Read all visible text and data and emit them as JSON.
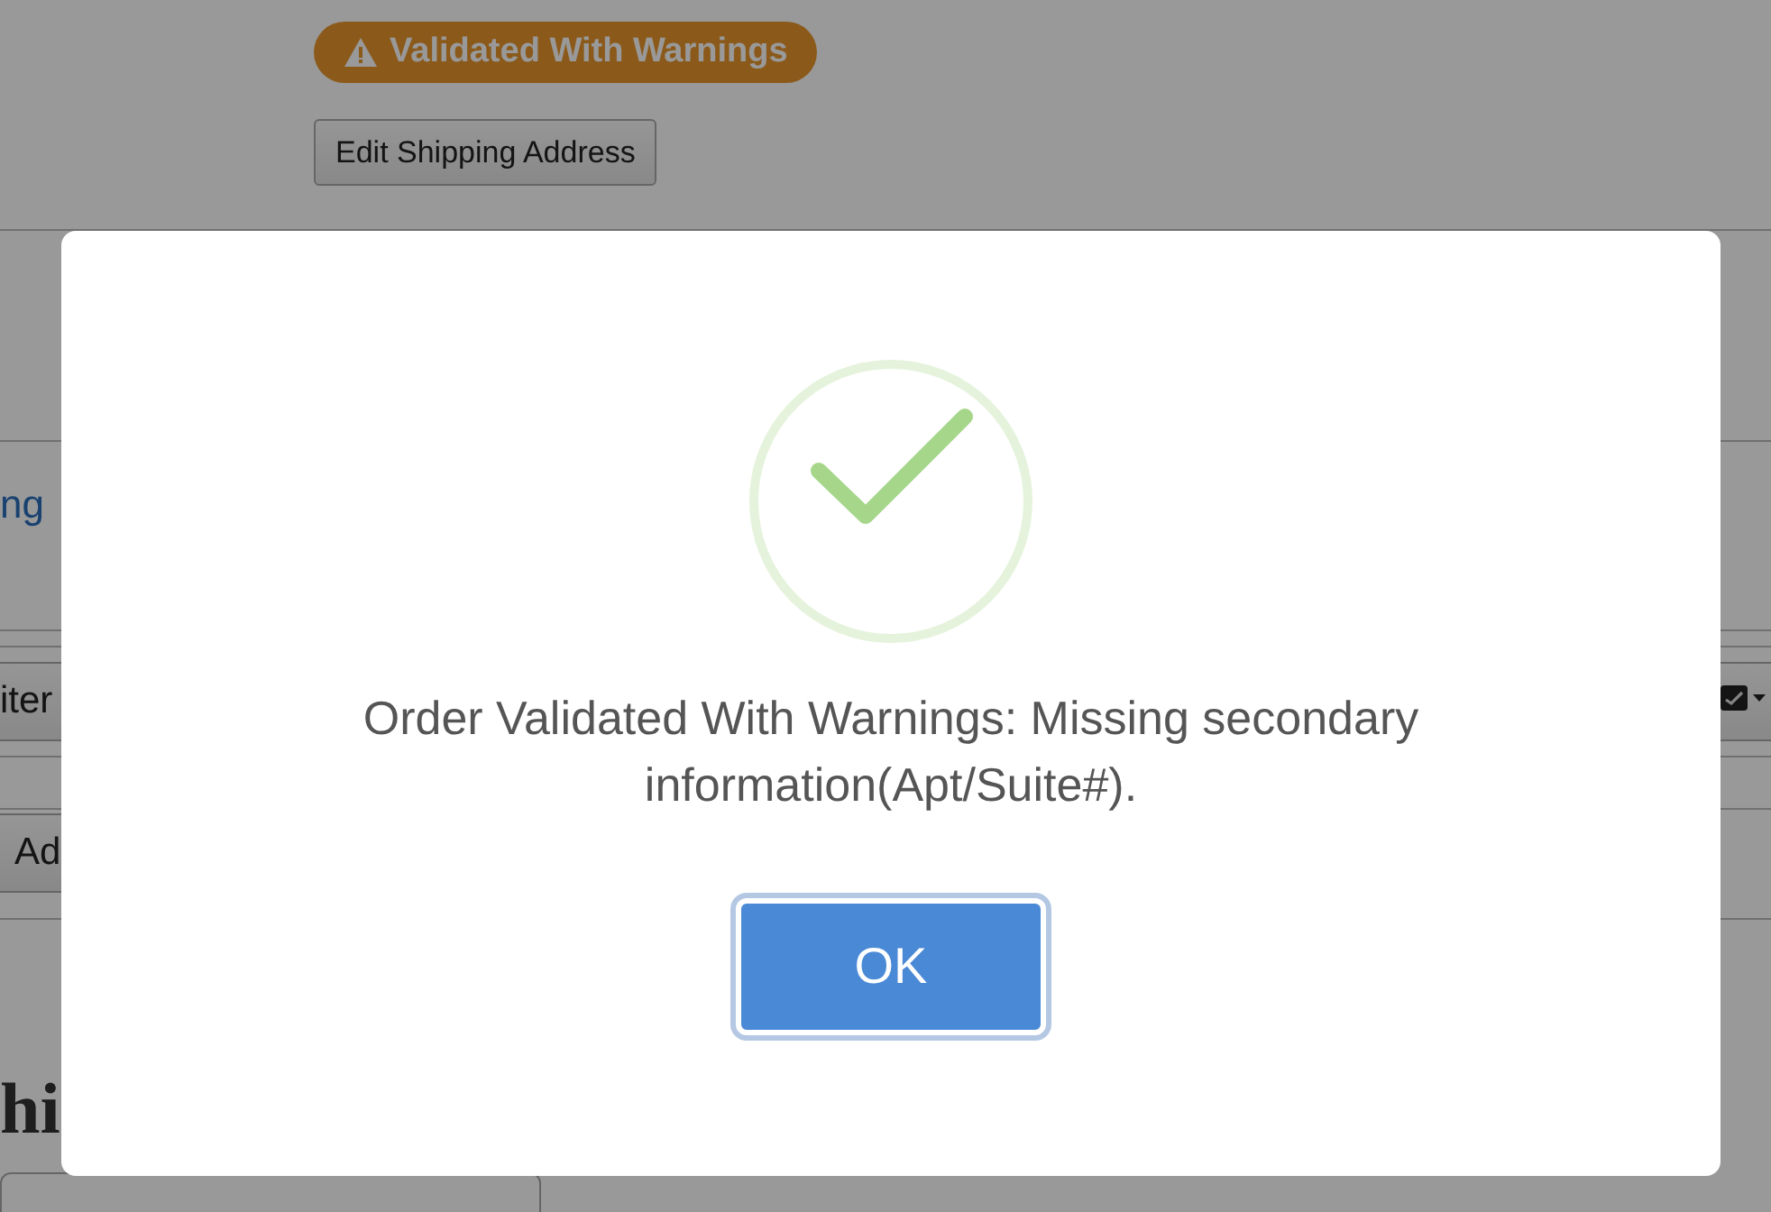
{
  "page": {
    "status_badge": {
      "label": "Validated With Warnings"
    },
    "edit_button": "Edit Shipping Address",
    "link": "ng",
    "toolbar_button": "iter",
    "add_button": "Ad",
    "heading": "hi"
  },
  "modal": {
    "kind": "success",
    "message": "Order Validated With Warnings: Missing secondary information(Apt/Suite#).",
    "button": "OK"
  }
}
